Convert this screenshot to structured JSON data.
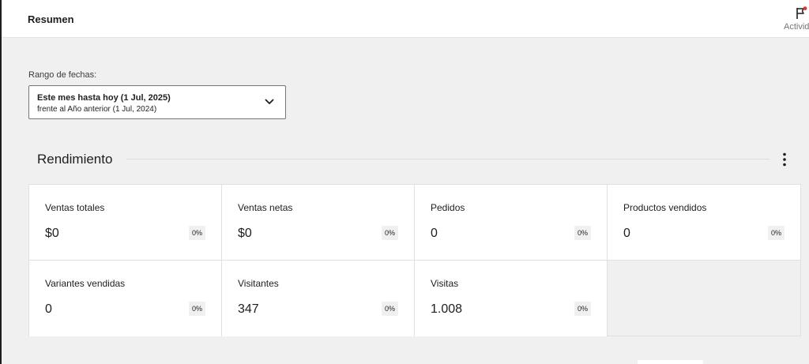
{
  "header": {
    "title": "Resumen",
    "activity_label": "Activid",
    "activity_icon": "flag-icon",
    "activity_badge_color": "#d63638"
  },
  "date_range": {
    "label": "Rango de fechas:",
    "primary": "Este mes hasta hoy (1 Jul, 2025)",
    "secondary": "frente al Año anterior (1 Jul, 2024)",
    "icon": "chevron-down-icon"
  },
  "performance": {
    "title": "Rendimiento",
    "menu_icon": "more-vertical-icon",
    "cards": [
      {
        "label": "Ventas totales",
        "value": "$0",
        "delta": "0%"
      },
      {
        "label": "Ventas netas",
        "value": "$0",
        "delta": "0%"
      },
      {
        "label": "Pedidos",
        "value": "0",
        "delta": "0%"
      },
      {
        "label": "Productos vendidos",
        "value": "0",
        "delta": "0%"
      },
      {
        "label": "Variantes vendidas",
        "value": "0",
        "delta": "0%"
      },
      {
        "label": "Visitantes",
        "value": "347",
        "delta": "0%"
      },
      {
        "label": "Visitas",
        "value": "1.008",
        "delta": "0%"
      }
    ]
  }
}
